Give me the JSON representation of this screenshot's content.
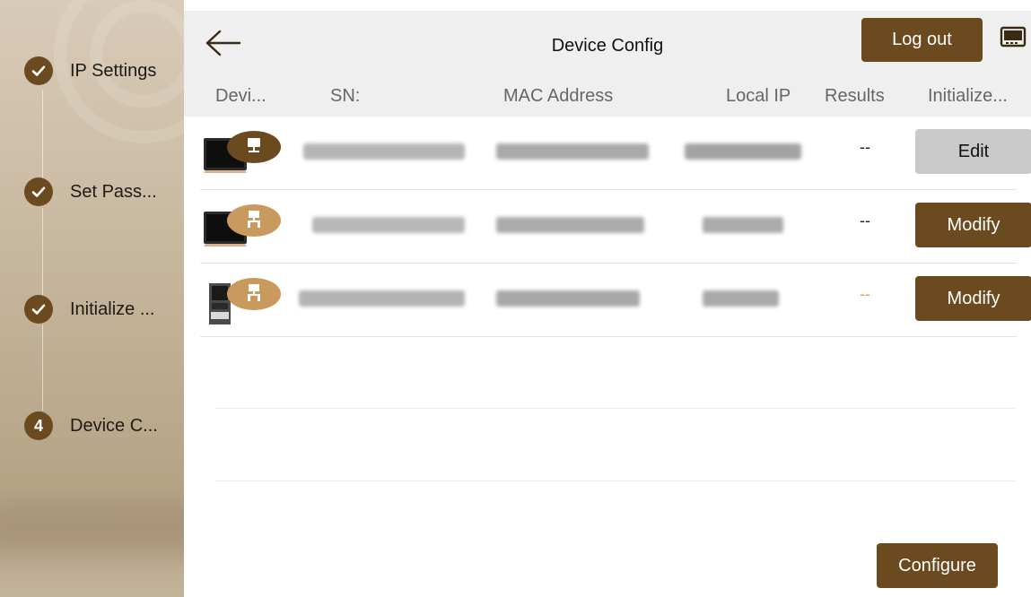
{
  "window": {
    "title": "Device Config"
  },
  "header": {
    "logout_label": "Log out"
  },
  "steps": [
    {
      "badge": "check",
      "label": "IP Settings"
    },
    {
      "badge": "check",
      "label": "Set Pass..."
    },
    {
      "badge": "check",
      "label": "Initialize ..."
    },
    {
      "badge": "4",
      "label": "Device C..."
    }
  ],
  "table": {
    "columns": [
      "Devi...",
      "SN:",
      "MAC Address",
      "Local IP",
      "Results",
      "Initialize..."
    ],
    "rows": [
      {
        "device_icon": "indoor-monitor-icon",
        "badge_icon": "network-single-icon",
        "results": "--",
        "action": "Edit",
        "action_style": "secondary"
      },
      {
        "device_icon": "indoor-monitor-icon",
        "badge_icon": "network-tree-icon",
        "results": "--",
        "action": "Modify",
        "action_style": "primary"
      },
      {
        "device_icon": "door-station-icon",
        "badge_icon": "network-tree-icon",
        "results": "--",
        "action": "Modify",
        "action_style": "primary"
      }
    ]
  },
  "footer": {
    "configure_label": "Configure"
  },
  "colors": {
    "accent": "#6b4a1f",
    "secondary_button": "#c9c9c9",
    "warning_text": "#e6a33a",
    "header_bg": "#efefef"
  }
}
